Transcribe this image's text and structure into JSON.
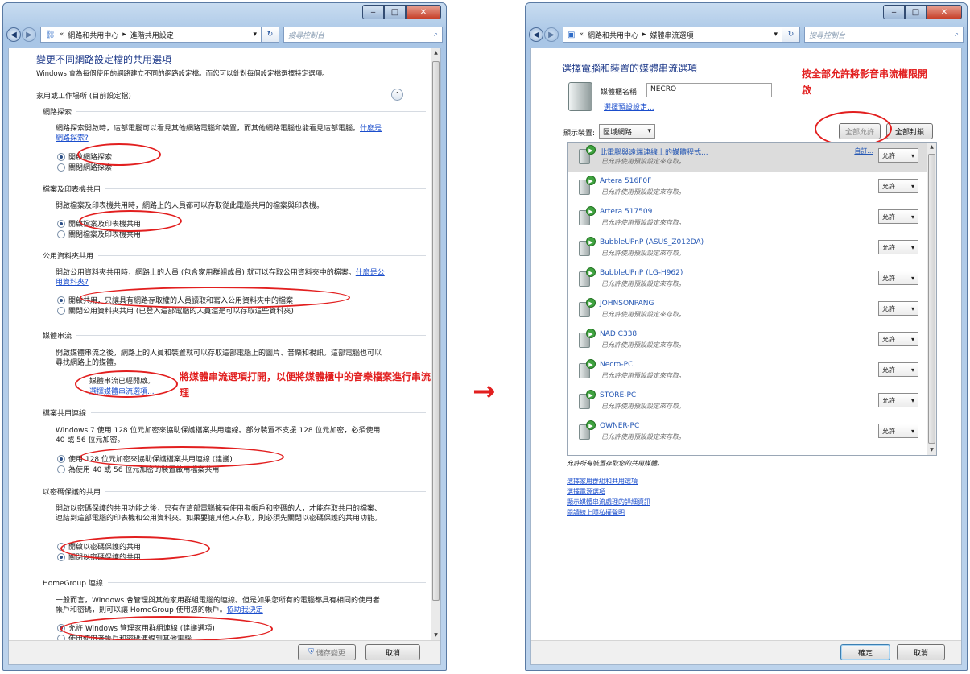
{
  "left": {
    "breadcrumb": [
      "«",
      "網路和共用中心",
      "進階共用設定"
    ],
    "search_placeholder": "搜尋控制台",
    "page_title": "變更不同網路設定檔的共用選項",
    "intro": "Windows 會為每個使用的網路建立不同的網路設定檔。而您可以針對每個設定檔選擇特定選項。",
    "profile_header": "家用或工作場所 (目前設定檔)",
    "sections": {
      "discovery": {
        "title": "網路探索",
        "desc": "網路探索開啟時，這部電腦可以看見其他網路電腦和裝置，而其他網路電腦也能看見這部電腦。",
        "link": "什麼是網路探索?",
        "opt_on": "開啟網路探索",
        "opt_off": "關閉網路探索"
      },
      "printer": {
        "title": "檔案及印表機共用",
        "desc": "開啟檔案及印表機共用時，網路上的人員都可以存取從此電腦共用的檔案與印表機。",
        "opt_on": "開啟檔案及印表機共用",
        "opt_off": "關閉檔案及印表機共用"
      },
      "public": {
        "title": "公用資料夾共用",
        "desc": "開啟公用資料夾共用時，網路上的人員 (包含家用群組成員) 就可以存取公用資料夾中的檔案。",
        "link": "什麼是公用資料夾?",
        "opt_on": "開啟共用，只讓具有網路存取權的人員讀取和寫入公用資料夾中的檔案",
        "opt_off": "關閉公用資料夾共用 (已登入這部電腦的人員還是可以存取這些資料夾)"
      },
      "media": {
        "title": "媒體串流",
        "desc": "開啟媒體串流之後，網路上的人員和裝置就可以存取這部電腦上的圖片、音樂和視訊。這部電腦也可以尋找網路上的媒體。",
        "status": "媒體串流已經開啟。",
        "link": "選擇媒體串流選項..."
      },
      "encryption": {
        "title": "檔案共用連線",
        "desc": "Windows 7 使用 128 位元加密來協助保護檔案共用連線。部分裝置不支援 128 位元加密，必須使用 40 或 56 位元加密。",
        "opt_on": "使用 128 位元加密來協助保護檔案共用連線 (建議)",
        "opt_off": "為使用 40 或 56 位元加密的裝置啟用檔案共用"
      },
      "password": {
        "title": "以密碼保護的共用",
        "desc": "開啟以密碼保護的共用功能之後，只有在這部電腦擁有使用者帳戶和密碼的人，才能存取共用的檔案、連結到這部電腦的印表機和公用資料夾。如果要讓其他人存取，則必須先關閉以密碼保護的共用功能。",
        "opt_a": "開啟以密碼保護的共用",
        "opt_b": "關閉以密碼保護的共用"
      },
      "homegroup": {
        "title": "HomeGroup 連線",
        "desc": "一般而言，Windows 會管理與其他家用群組電腦的連線。但是如果您所有的電腦都具有相同的使用者帳戶和密碼，則可以讓 HomeGroup 使用您的帳戶。",
        "link": "協助我決定",
        "opt_on": "允許 Windows 管理家用群組連線 (建議選項)",
        "opt_off": "使用使用者帳戶和密碼連線到其他電腦"
      }
    },
    "annotation": "將媒體串流選項打開，以便將媒體櫃中的音樂檔案進行串流處理",
    "save_label": "儲存變更",
    "cancel_label": "取消"
  },
  "arrow_glyph": "→",
  "right": {
    "breadcrumb": [
      "«",
      "網路和共用中心",
      "媒體串流選項"
    ],
    "search_placeholder": "搜尋控制台",
    "page_title": "選擇電腦和裝置的媒體串流選項",
    "lib_label": "媒體櫃名稱:",
    "lib_name": "NECRO",
    "default_link": "選擇預設設定...",
    "show_label": "顯示裝置:",
    "show_value": "區域網路",
    "allow_all": "全部允許",
    "block_all": "全部封鎖",
    "annotation": "按全部允許將影音串流權限開啟",
    "devices": [
      {
        "name": "此電腦與遠端連線上的媒體程式...",
        "status": "已允許使用預設設定來存取。",
        "custom": "自訂...",
        "value": "允許"
      },
      {
        "name": "Artera 516F0F",
        "status": "已允許使用預設設定來存取。",
        "value": "允許"
      },
      {
        "name": "Artera 517509",
        "status": "已允許使用預設設定來存取。",
        "value": "允許"
      },
      {
        "name": "BubbleUPnP (ASUS_Z012DA)",
        "status": "已允許使用預設設定來存取。",
        "value": "允許"
      },
      {
        "name": "BubbleUPnP (LG-H962)",
        "status": "已允許使用預設設定來存取。",
        "value": "允許"
      },
      {
        "name": "JOHNSONPANG",
        "status": "已允許使用預設設定來存取。",
        "value": "允許"
      },
      {
        "name": "NAD C338",
        "status": "已允許使用預設設定來存取。",
        "value": "允許"
      },
      {
        "name": "Necro-PC",
        "status": "已允許使用預設設定來存取。",
        "value": "允許"
      },
      {
        "name": "STORE-PC",
        "status": "已允許使用預設設定來存取。",
        "value": "允許"
      },
      {
        "name": "OWNER-PC",
        "status": "已允許使用預設設定來存取。",
        "value": "允許"
      }
    ],
    "all_allowed": "允許所有裝置存取您的共用媒體。",
    "links": [
      "選擇家用群組和共用選項",
      "選擇電源選項",
      "顯示媒體串流處理的詳細資訊",
      "閱讀線上隱私權聲明"
    ],
    "ok_label": "確定",
    "cancel_label": "取消"
  }
}
